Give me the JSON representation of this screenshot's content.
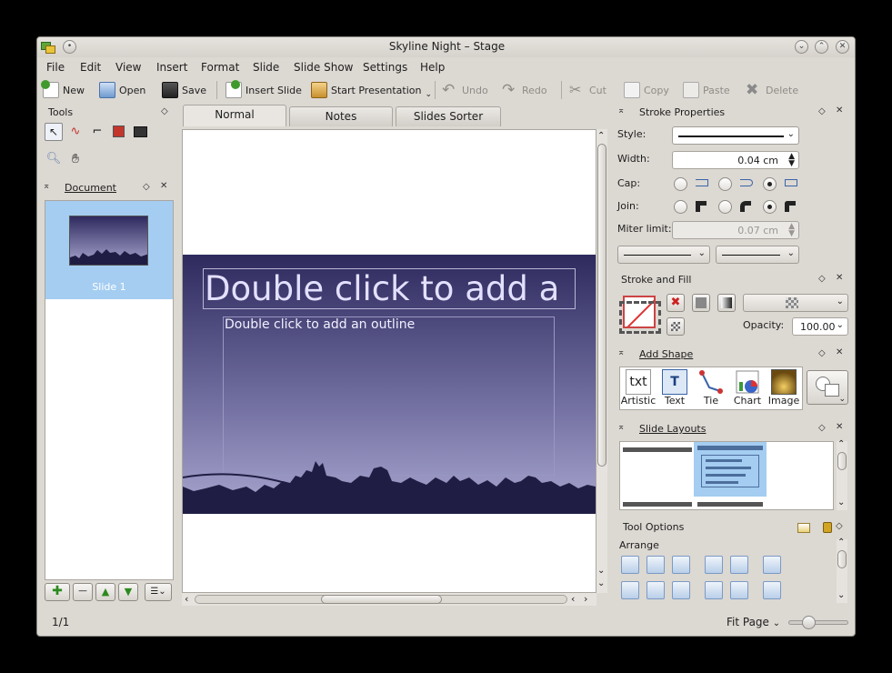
{
  "window": {
    "title": "Skyline Night – Stage"
  },
  "menu": [
    "File",
    "Edit",
    "View",
    "Insert",
    "Format",
    "Slide",
    "Slide Show",
    "Settings",
    "Help"
  ],
  "toolbar": {
    "new": "New",
    "open": "Open",
    "save": "Save",
    "insert_slide": "Insert Slide",
    "start_presentation": "Start Presentation",
    "undo": "Undo",
    "redo": "Redo",
    "cut": "Cut",
    "copy": "Copy",
    "paste": "Paste",
    "delete": "Delete"
  },
  "tools_panel": {
    "title": "Tools"
  },
  "document_panel": {
    "title": "Document",
    "slides": [
      {
        "label": "Slide 1"
      }
    ]
  },
  "tabs": [
    "Normal",
    "Notes",
    "Slides Sorter"
  ],
  "slide": {
    "title_placeholder": "Double click to add a",
    "outline_placeholder": "Double click to add an outline"
  },
  "stroke_properties": {
    "title": "Stroke Properties",
    "style_label": "Style:",
    "width_label": "Width:",
    "width_value": "0.04 cm",
    "cap_label": "Cap:",
    "join_label": "Join:",
    "miter_label": "Miter limit:",
    "miter_value": "0.07 cm"
  },
  "stroke_fill": {
    "title": "Stroke and Fill",
    "opacity_label": "Opacity:",
    "opacity_value": "100.00"
  },
  "add_shape": {
    "title": "Add Shape",
    "shapes": [
      "Artistic",
      "Text",
      "Tie",
      "Chart",
      "Image"
    ]
  },
  "slide_layouts": {
    "title": "Slide Layouts"
  },
  "tool_options": {
    "title": "Tool Options",
    "arrange_label": "Arrange"
  },
  "status": {
    "page": "1/1",
    "zoom": "Fit Page"
  },
  "colors": {
    "accent": "#a4cdf1",
    "slide_top": "#2e2a5e",
    "slide_bottom": "#a9a6d0",
    "skyline": "#201d44"
  }
}
